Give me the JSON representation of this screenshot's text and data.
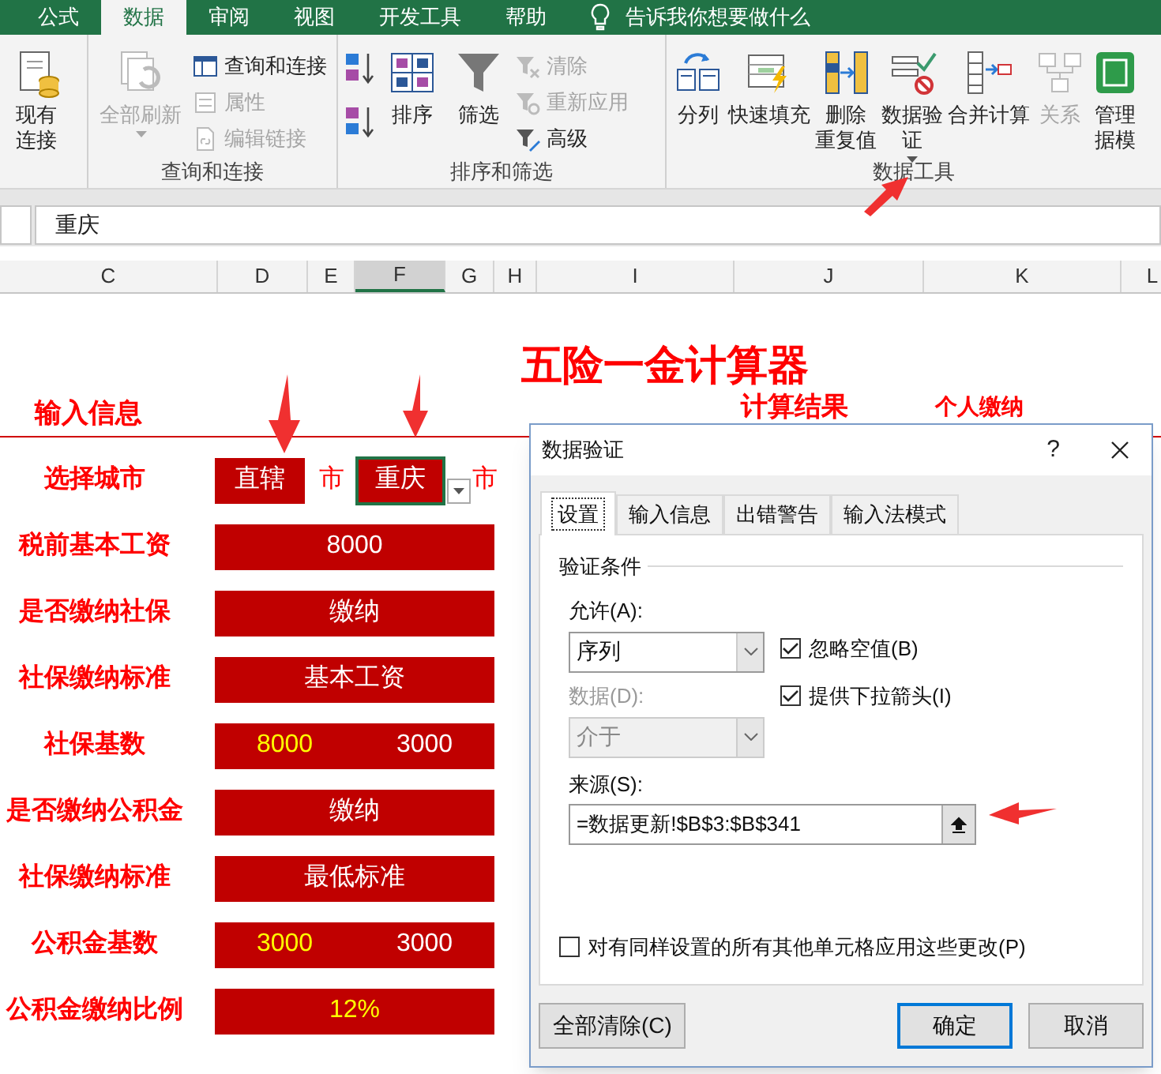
{
  "ribbon_tabs": [
    {
      "label": "公式",
      "selected": false
    },
    {
      "label": "数据",
      "selected": true
    },
    {
      "label": "审阅",
      "selected": false
    },
    {
      "label": "视图",
      "selected": false
    },
    {
      "label": "开发工具",
      "selected": false
    },
    {
      "label": "帮助",
      "selected": false
    }
  ],
  "tell_me": "告诉我你想要做什么",
  "ribbon_groups": [
    {
      "items": [
        {
          "kind": "large",
          "lines": [
            "现有",
            "连接"
          ],
          "disabled": false,
          "dropdown": false
        }
      ]
    },
    {
      "label": "查询和连接",
      "items": [
        {
          "kind": "large",
          "lines": [
            "全部刷新"
          ],
          "disabled": true,
          "dropdown": true
        },
        {
          "kind": "stack",
          "items": [
            {
              "label": "查询和连接",
              "disabled": false
            },
            {
              "label": "属性",
              "disabled": true
            },
            {
              "label": "编辑链接",
              "disabled": true
            }
          ]
        }
      ]
    },
    {
      "label": "排序和筛选",
      "items": [
        {
          "kind": "sort_stack"
        },
        {
          "kind": "large",
          "lines": [
            "排序"
          ],
          "disabled": false,
          "dropdown": false
        },
        {
          "kind": "large",
          "lines": [
            "筛选"
          ],
          "disabled": false,
          "dropdown": false
        },
        {
          "kind": "stack",
          "items": [
            {
              "label": "清除",
              "disabled": true
            },
            {
              "label": "重新应用",
              "disabled": true
            },
            {
              "label": "高级",
              "disabled": false
            }
          ]
        }
      ]
    },
    {
      "label": "数据工具",
      "items": [
        {
          "kind": "large",
          "lines": [
            "分列"
          ],
          "disabled": false,
          "dropdown": false
        },
        {
          "kind": "large",
          "lines": [
            "快速填充"
          ],
          "disabled": false,
          "dropdown": false
        },
        {
          "kind": "large",
          "lines": [
            "删除",
            "重复值"
          ],
          "disabled": false,
          "dropdown": false
        },
        {
          "kind": "large",
          "lines": [
            "数据验",
            "证"
          ],
          "disabled": false,
          "dropdown": true
        },
        {
          "kind": "large",
          "lines": [
            "合并计算"
          ],
          "disabled": false,
          "dropdown": false
        },
        {
          "kind": "large",
          "lines": [
            "关系"
          ],
          "disabled": true,
          "dropdown": false
        },
        {
          "kind": "large",
          "lines": [
            "管理",
            "据模"
          ],
          "disabled": false,
          "dropdown": false
        }
      ]
    }
  ],
  "formula_bar": {
    "value": "重庆"
  },
  "columns": [
    {
      "label": "C",
      "selected": false
    },
    {
      "label": "D",
      "selected": false
    },
    {
      "label": "E",
      "selected": false
    },
    {
      "label": "F",
      "selected": true
    },
    {
      "label": "G",
      "selected": false
    },
    {
      "label": "H",
      "selected": false
    },
    {
      "label": "I",
      "selected": false
    },
    {
      "label": "J",
      "selected": false
    },
    {
      "label": "K",
      "selected": false
    },
    {
      "label": "L",
      "selected": false
    }
  ],
  "sheet": {
    "title": "五险一金计算器",
    "input_heading": "输入信息",
    "result_heading": "计算结果",
    "result_subheading": "个人缴纳",
    "rows": [
      {
        "kind": "city",
        "label": "选择城市",
        "prefix": "直辖",
        "unit_1": "市",
        "value": "重庆",
        "unit_2": "市"
      },
      {
        "kind": "single",
        "label": "税前基本工资",
        "values": [
          {
            "text": "8000",
            "highlighted": false
          }
        ]
      },
      {
        "kind": "single",
        "label": "是否缴纳社保",
        "values": [
          {
            "text": "缴纳",
            "highlighted": false
          }
        ]
      },
      {
        "kind": "single",
        "label": "社保缴纳标准",
        "values": [
          {
            "text": "基本工资",
            "highlighted": false
          }
        ]
      },
      {
        "kind": "pair",
        "label": "社保基数",
        "values": [
          {
            "text": "8000",
            "highlighted": true
          },
          {
            "text": "3000",
            "highlighted": false
          }
        ]
      },
      {
        "kind": "single",
        "label": "是否缴纳公积金",
        "values": [
          {
            "text": "缴纳",
            "highlighted": false
          }
        ]
      },
      {
        "kind": "single",
        "label": "社保缴纳标准",
        "values": [
          {
            "text": "最低标准",
            "highlighted": false
          }
        ]
      },
      {
        "kind": "pair",
        "label": "公积金基数",
        "values": [
          {
            "text": "3000",
            "highlighted": true
          },
          {
            "text": "3000",
            "highlighted": false
          }
        ]
      },
      {
        "kind": "single",
        "label": "公积金缴纳比例",
        "values": [
          {
            "text": "12%",
            "highlighted": true
          }
        ]
      }
    ]
  },
  "dialog": {
    "title": "数据验证",
    "help": "?",
    "tabs": [
      {
        "label": "设置",
        "selected": true
      },
      {
        "label": "输入信息",
        "selected": false
      },
      {
        "label": "出错警告",
        "selected": false
      },
      {
        "label": "输入法模式",
        "selected": false
      }
    ],
    "section": "验证条件",
    "allow": {
      "label": "允许(A):",
      "value": "序列",
      "disabled": false
    },
    "data": {
      "label": "数据(D):",
      "value": "介于",
      "disabled": true
    },
    "checkboxes": [
      {
        "label": "忽略空值(B)",
        "checked": true
      },
      {
        "label": "提供下拉箭头(I)",
        "checked": true
      }
    ],
    "source": {
      "label": "来源(S):",
      "value": "=数据更新!$B$3:$B$341"
    },
    "apply_all": {
      "label": "对有同样设置的所有其他单元格应用这些更改(P)",
      "checked": false
    },
    "buttons": [
      {
        "label": "全部清除(C)",
        "default": false
      },
      {
        "label": "确定",
        "default": true
      },
      {
        "label": "取消",
        "default": false
      }
    ]
  }
}
